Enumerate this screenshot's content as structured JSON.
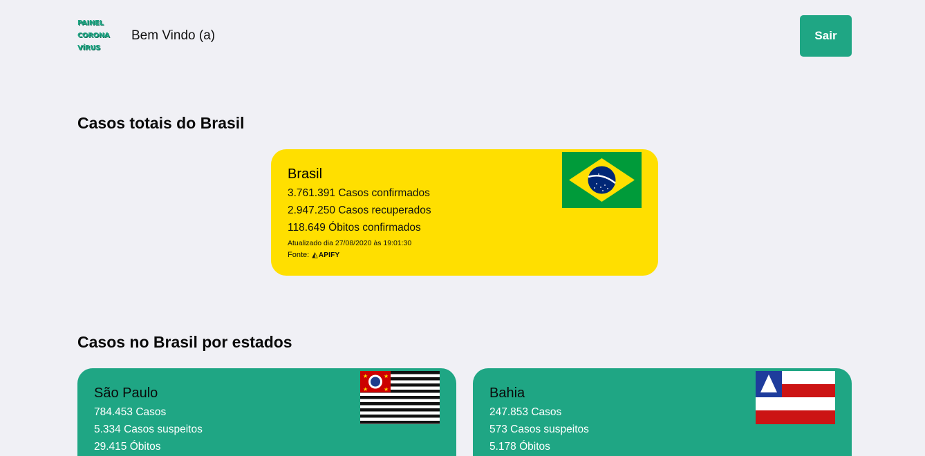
{
  "header": {
    "logo_lines": [
      "PAINEL",
      "CORONA",
      "VÍRUS"
    ],
    "welcome": "Bem Vindo (a)",
    "logout_label": "Sair"
  },
  "sections": {
    "total_title": "Casos totais do Brasil",
    "states_title": "Casos no Brasil por estados"
  },
  "brasil": {
    "name": "Brasil",
    "confirmed": "3.761.391 Casos confirmados",
    "recovered": "2.947.250 Casos recuperados",
    "deaths": "118.649 Óbitos confirmados",
    "updated": "Atualizado dia 27/08/2020 às 19:01:30",
    "source_label": "Fonte:",
    "source_name": "APIFY",
    "flag_icon": "brazil-flag"
  },
  "states": [
    {
      "name": "São Paulo",
      "cases": "784.453 Casos",
      "suspects": "5.334 Casos suspeitos",
      "deaths": "29.415 Óbitos",
      "flag_icon": "sao-paulo-flag"
    },
    {
      "name": "Bahia",
      "cases": "247.853 Casos",
      "suspects": "573 Casos suspeitos",
      "deaths": "5.178 Óbitos",
      "flag_icon": "bahia-flag"
    }
  ],
  "colors": {
    "background": "#f0f0f5",
    "accent": "#1fa684",
    "brasil_card": "#ffdf00"
  }
}
